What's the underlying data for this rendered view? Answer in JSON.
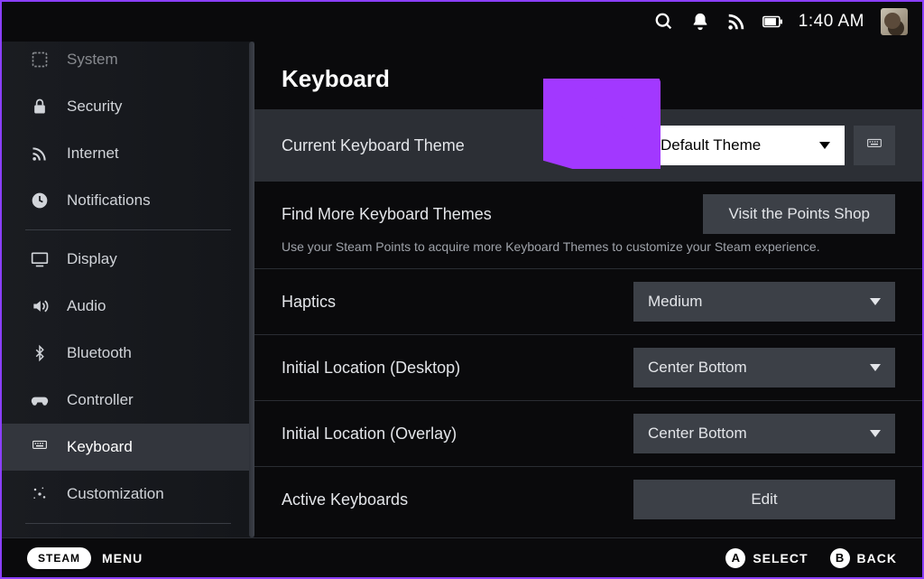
{
  "topbar": {
    "time": "1:40 AM"
  },
  "sidebar": {
    "items": [
      {
        "label": "System",
        "icon": "system"
      },
      {
        "label": "Security",
        "icon": "lock"
      },
      {
        "label": "Internet",
        "icon": "wifi"
      },
      {
        "label": "Notifications",
        "icon": "bell"
      },
      {
        "label": "Display",
        "icon": "display"
      },
      {
        "label": "Audio",
        "icon": "audio"
      },
      {
        "label": "Bluetooth",
        "icon": "bluetooth"
      },
      {
        "label": "Controller",
        "icon": "controller"
      },
      {
        "label": "Keyboard",
        "icon": "keyboard"
      },
      {
        "label": "Customization",
        "icon": "sparkle"
      }
    ],
    "active_index": 8
  },
  "page": {
    "title": "Keyboard",
    "theme": {
      "label": "Current Keyboard Theme",
      "value": "Default Theme"
    },
    "find_more": {
      "label": "Find More Keyboard Themes",
      "button": "Visit the Points Shop",
      "desc": "Use your Steam Points to acquire more Keyboard Themes to customize your Steam experience."
    },
    "haptics": {
      "label": "Haptics",
      "value": "Medium"
    },
    "loc_desktop": {
      "label": "Initial Location (Desktop)",
      "value": "Center Bottom"
    },
    "loc_overlay": {
      "label": "Initial Location (Overlay)",
      "value": "Center Bottom"
    },
    "active_kb": {
      "label": "Active Keyboards",
      "button": "Edit"
    }
  },
  "footer": {
    "steam": "STEAM",
    "menu": "MENU",
    "hints": [
      {
        "btn": "A",
        "label": "SELECT"
      },
      {
        "btn": "B",
        "label": "BACK"
      }
    ]
  },
  "annotations": {
    "arrow_color": "#a238ff"
  }
}
